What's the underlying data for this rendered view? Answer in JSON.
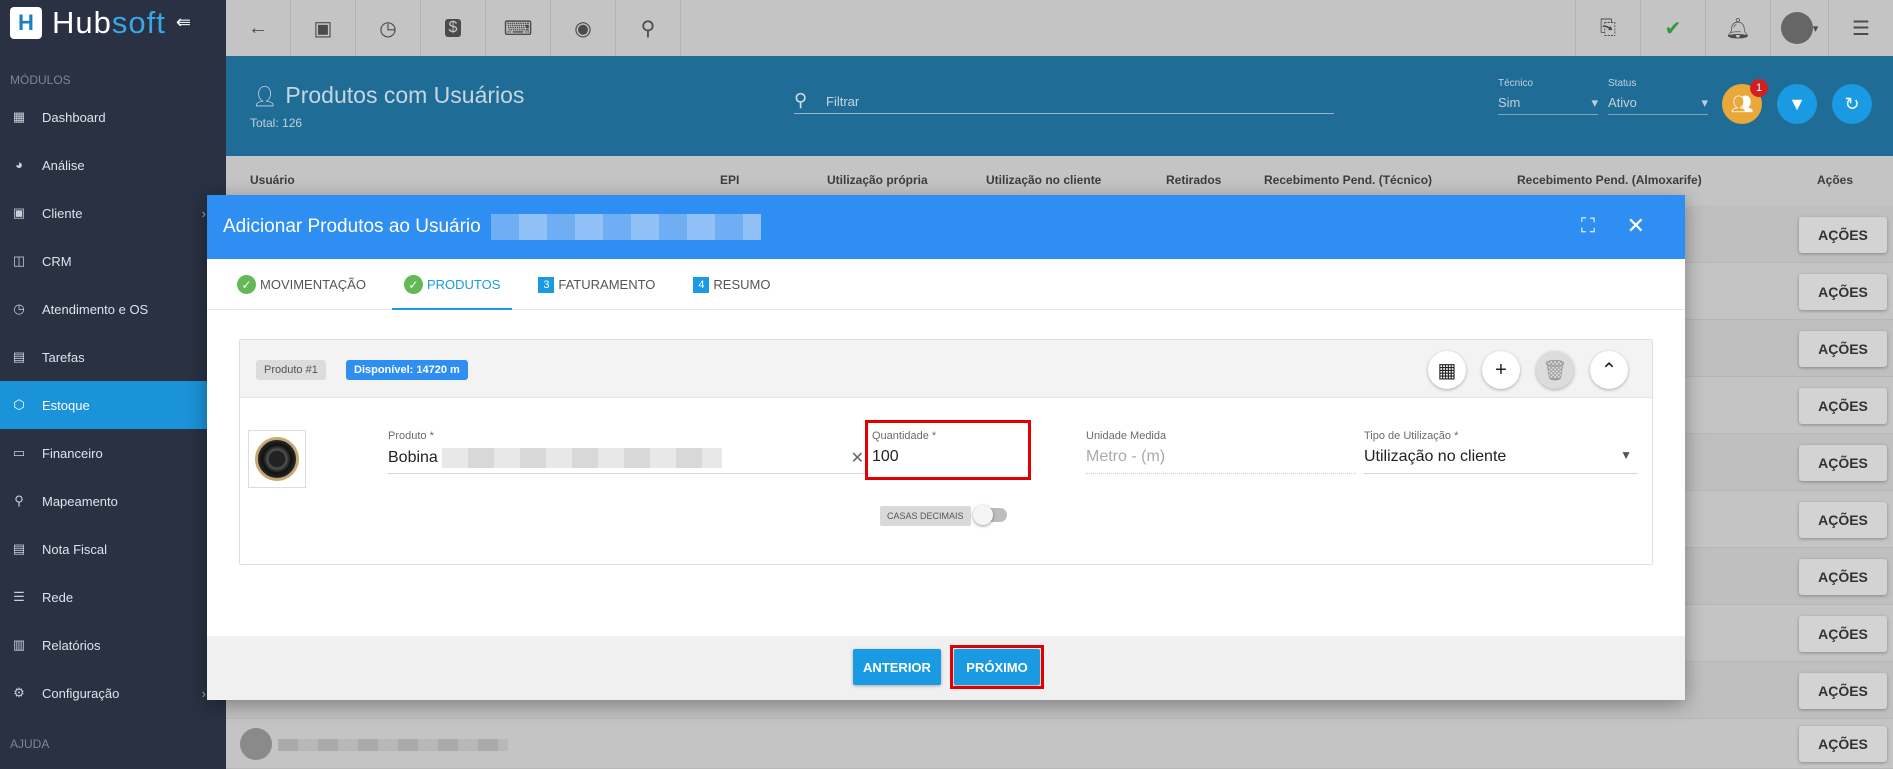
{
  "app": {
    "logo_letter": "H",
    "name_part1": "Hub",
    "name_part2": "soft"
  },
  "sidebar": {
    "section_modules": "MÓDULOS",
    "items": [
      {
        "label": "Dashboard",
        "icon": "dashboard-icon"
      },
      {
        "label": "Análise",
        "icon": "pie-chart-icon"
      },
      {
        "label": "Cliente",
        "icon": "contact-card-icon",
        "has_submenu": true
      },
      {
        "label": "CRM",
        "icon": "board-icon"
      },
      {
        "label": "Atendimento e OS",
        "icon": "calendar-clock-icon"
      },
      {
        "label": "Tarefas",
        "icon": "calendar-grid-icon"
      },
      {
        "label": "Estoque",
        "icon": "box-icon",
        "active": true
      },
      {
        "label": "Financeiro",
        "icon": "money-icon"
      },
      {
        "label": "Mapeamento",
        "icon": "map-pin-icon"
      },
      {
        "label": "Nota Fiscal",
        "icon": "document-icon"
      },
      {
        "label": "Rede",
        "icon": "server-icon"
      },
      {
        "label": "Relatórios",
        "icon": "report-icon"
      },
      {
        "label": "Configuração",
        "icon": "gear-icon",
        "has_submenu": true
      }
    ],
    "section_help": "AJUDA"
  },
  "page": {
    "title": "Produtos com Usuários",
    "total": "Total: 126",
    "filter_placeholder": "Filtrar",
    "tecnico_label": "Técnico",
    "tecnico_value": "Sim",
    "status_label": "Status",
    "status_value": "Ativo",
    "notification_count": "1"
  },
  "table": {
    "columns": [
      "Usuário",
      "EPI",
      "Utilização própria",
      "Utilização no cliente",
      "Retirados",
      "Recebimento Pend. (Técnico)",
      "Recebimento Pend. (Almoxarife)",
      "Ações"
    ],
    "action_label": "AÇÕES"
  },
  "modal": {
    "title": "Adicionar Produtos ao Usuário",
    "tabs": [
      {
        "label": "MOVIMENTAÇÃO",
        "marker": "✓",
        "state": "done"
      },
      {
        "label": "PRODUTOS",
        "marker": "✓",
        "state": "active"
      },
      {
        "label": "FATURAMENTO",
        "marker": "3",
        "state": "pending"
      },
      {
        "label": "RESUMO",
        "marker": "4",
        "state": "pending"
      }
    ],
    "product": {
      "chip_label": "Produto #1",
      "available": "Disponível: 14720 m",
      "produto_label": "Produto *",
      "produto_value": "Bobina",
      "quantidade_label": "Quantidade *",
      "quantidade_value": "100",
      "unidade_label": "Unidade Medida",
      "unidade_value": "Metro - (m)",
      "tipo_label": "Tipo de Utilização *",
      "tipo_value": "Utilização no cliente",
      "casas_decimais": "CASAS DECIMAIS"
    },
    "buttons": {
      "anterior": "ANTERIOR",
      "proximo": "PRÓXIMO"
    }
  },
  "colors": {
    "accent": "#1a9ae3",
    "modal_header": "#2e8ef2",
    "sidebar": "#293142",
    "highlight": "#e00000"
  }
}
